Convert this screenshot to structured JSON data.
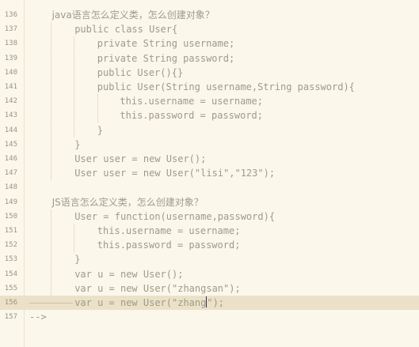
{
  "editor": {
    "lines": [
      {
        "no": "136",
        "indent": 2,
        "text": "java语言怎么定义类，怎么创建对象？",
        "cjk": true
      },
      {
        "no": "137",
        "indent": 4,
        "text": "public class User{"
      },
      {
        "no": "138",
        "indent": 6,
        "text": "private String username;"
      },
      {
        "no": "139",
        "indent": 6,
        "text": "private String password;"
      },
      {
        "no": "140",
        "indent": 6,
        "text": "public User(){}"
      },
      {
        "no": "141",
        "indent": 6,
        "text": "public User(String username,String password){"
      },
      {
        "no": "142",
        "indent": 8,
        "text": "this.username = username;"
      },
      {
        "no": "143",
        "indent": 8,
        "text": "this.password = password;"
      },
      {
        "no": "144",
        "indent": 6,
        "text": "}"
      },
      {
        "no": "145",
        "indent": 4,
        "text": "}"
      },
      {
        "no": "146",
        "indent": 4,
        "text": "User user = new User();"
      },
      {
        "no": "147",
        "indent": 4,
        "text": "User user = new User(\"lisi\",\"123\");"
      },
      {
        "no": "148",
        "indent": 0,
        "text": ""
      },
      {
        "no": "149",
        "indent": 2,
        "text": "JS语言怎么定义类，怎么创建对象？",
        "cjk": true
      },
      {
        "no": "150",
        "indent": 4,
        "text": "User = function(username,password){"
      },
      {
        "no": "151",
        "indent": 6,
        "text": "this.username = username;"
      },
      {
        "no": "152",
        "indent": 6,
        "text": "this.password = password;"
      },
      {
        "no": "153",
        "indent": 4,
        "text": "}"
      },
      {
        "no": "154",
        "indent": 4,
        "text": "var u = new User();"
      },
      {
        "no": "155",
        "indent": 4,
        "text": "var u = new User(\"zhangsan\");"
      },
      {
        "no": "156",
        "indent": 4,
        "text": "var u = new User(\"zhang",
        "after_cursor": "\");",
        "current": true
      },
      {
        "no": "157",
        "indent": 0,
        "text": "-->"
      }
    ]
  }
}
